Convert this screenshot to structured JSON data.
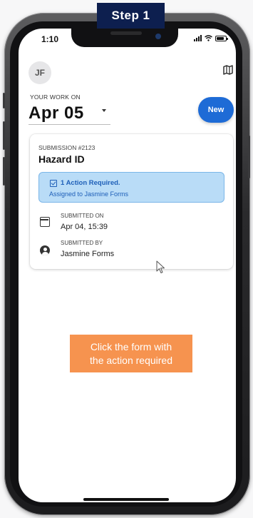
{
  "banner": {
    "label": "Step 1"
  },
  "status_bar": {
    "time": "1:10"
  },
  "header": {
    "avatar_initials": "JF"
  },
  "date_picker": {
    "label": "YOUR WORK ON",
    "value": "Apr 05"
  },
  "new_button": {
    "label": "New"
  },
  "submission": {
    "number": "SUBMISSION #2123",
    "title": "Hazard ID",
    "action": {
      "title": "1 Action Required.",
      "subtitle": "Assigned to Jasmine Forms"
    },
    "submitted_on": {
      "label": "SUBMITTED ON",
      "value": "Apr 04, 15:39"
    },
    "submitted_by": {
      "label": "SUBMITTED BY",
      "value": "Jasmine Forms"
    }
  },
  "instruction": {
    "line1": "Click the form with",
    "line2": "the action required"
  },
  "colors": {
    "primary_button": "#1e6bd6",
    "action_bg": "#b9dcf7",
    "action_text": "#1e5fb8",
    "instruction_bg": "#f6934f",
    "banner_bg": "#0d1f4f"
  },
  "icons": [
    "calendar-icon",
    "person-icon",
    "map-icon",
    "checkbox-icon",
    "signal-icon",
    "wifi-icon",
    "battery-icon",
    "cursor-icon"
  ]
}
